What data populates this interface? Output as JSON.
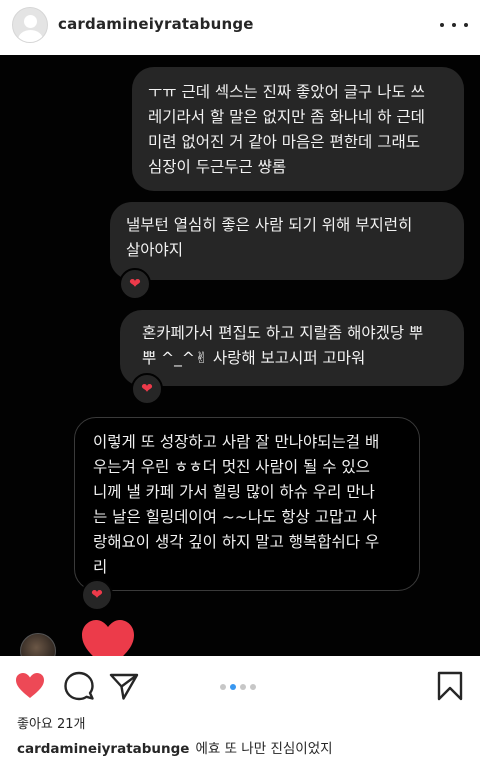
{
  "post": {
    "username": "cardamineiyratabunge",
    "likes_text": "좋아요 21개",
    "caption_user": "cardamineiyratabunge",
    "caption_text": "에효 또 나만 진심이었지",
    "carousel": {
      "count": 4,
      "active_index": 1
    }
  },
  "chat": {
    "messages": [
      {
        "text": "ㅜㅠ 근데 섹스는 진짜 좋았어 글구 나도 쓰\n레기라서 할 말은 없지만 좀 화나네 하 근데\n미련 없어진 거 같아 마음은 편한데 그래도\n심장이 두근두근 썅롬",
        "reaction": ""
      },
      {
        "text": "낼부턴 열심히 좋은 사람 되기 위해 부지런히\n살아야지",
        "reaction": "❤"
      },
      {
        "text": "혼카페가서 편집도 하고 지랄좀 해야겠당 뿌\n뿌 ^_^✌ 사랑해 보고시퍼 고마워",
        "reaction": "❤"
      },
      {
        "text": "이렇게 또 성장하고 사람 잘 만나야되는걸 배\n우는겨 우린 ㅎㅎ더 멋진 사람이 될 수 있으\n니께 낼 카페 가서 힐링 많이 하슈 우리 만나\n는 날은 힐링데이여 ~~나도 항상 고맙고 사\n랑해요이 생각 깊이 하지 말고 행복합쉬다 우\n리",
        "reaction": "❤"
      }
    ]
  },
  "colors": {
    "like_red": "#ed4956",
    "active_dot": "#3897f0",
    "bubble_bg": "#262626"
  },
  "icons": {
    "like": "heart-icon",
    "comment": "comment-icon",
    "share": "paper-plane-icon",
    "save": "bookmark-icon",
    "more": "more-dots-icon"
  }
}
